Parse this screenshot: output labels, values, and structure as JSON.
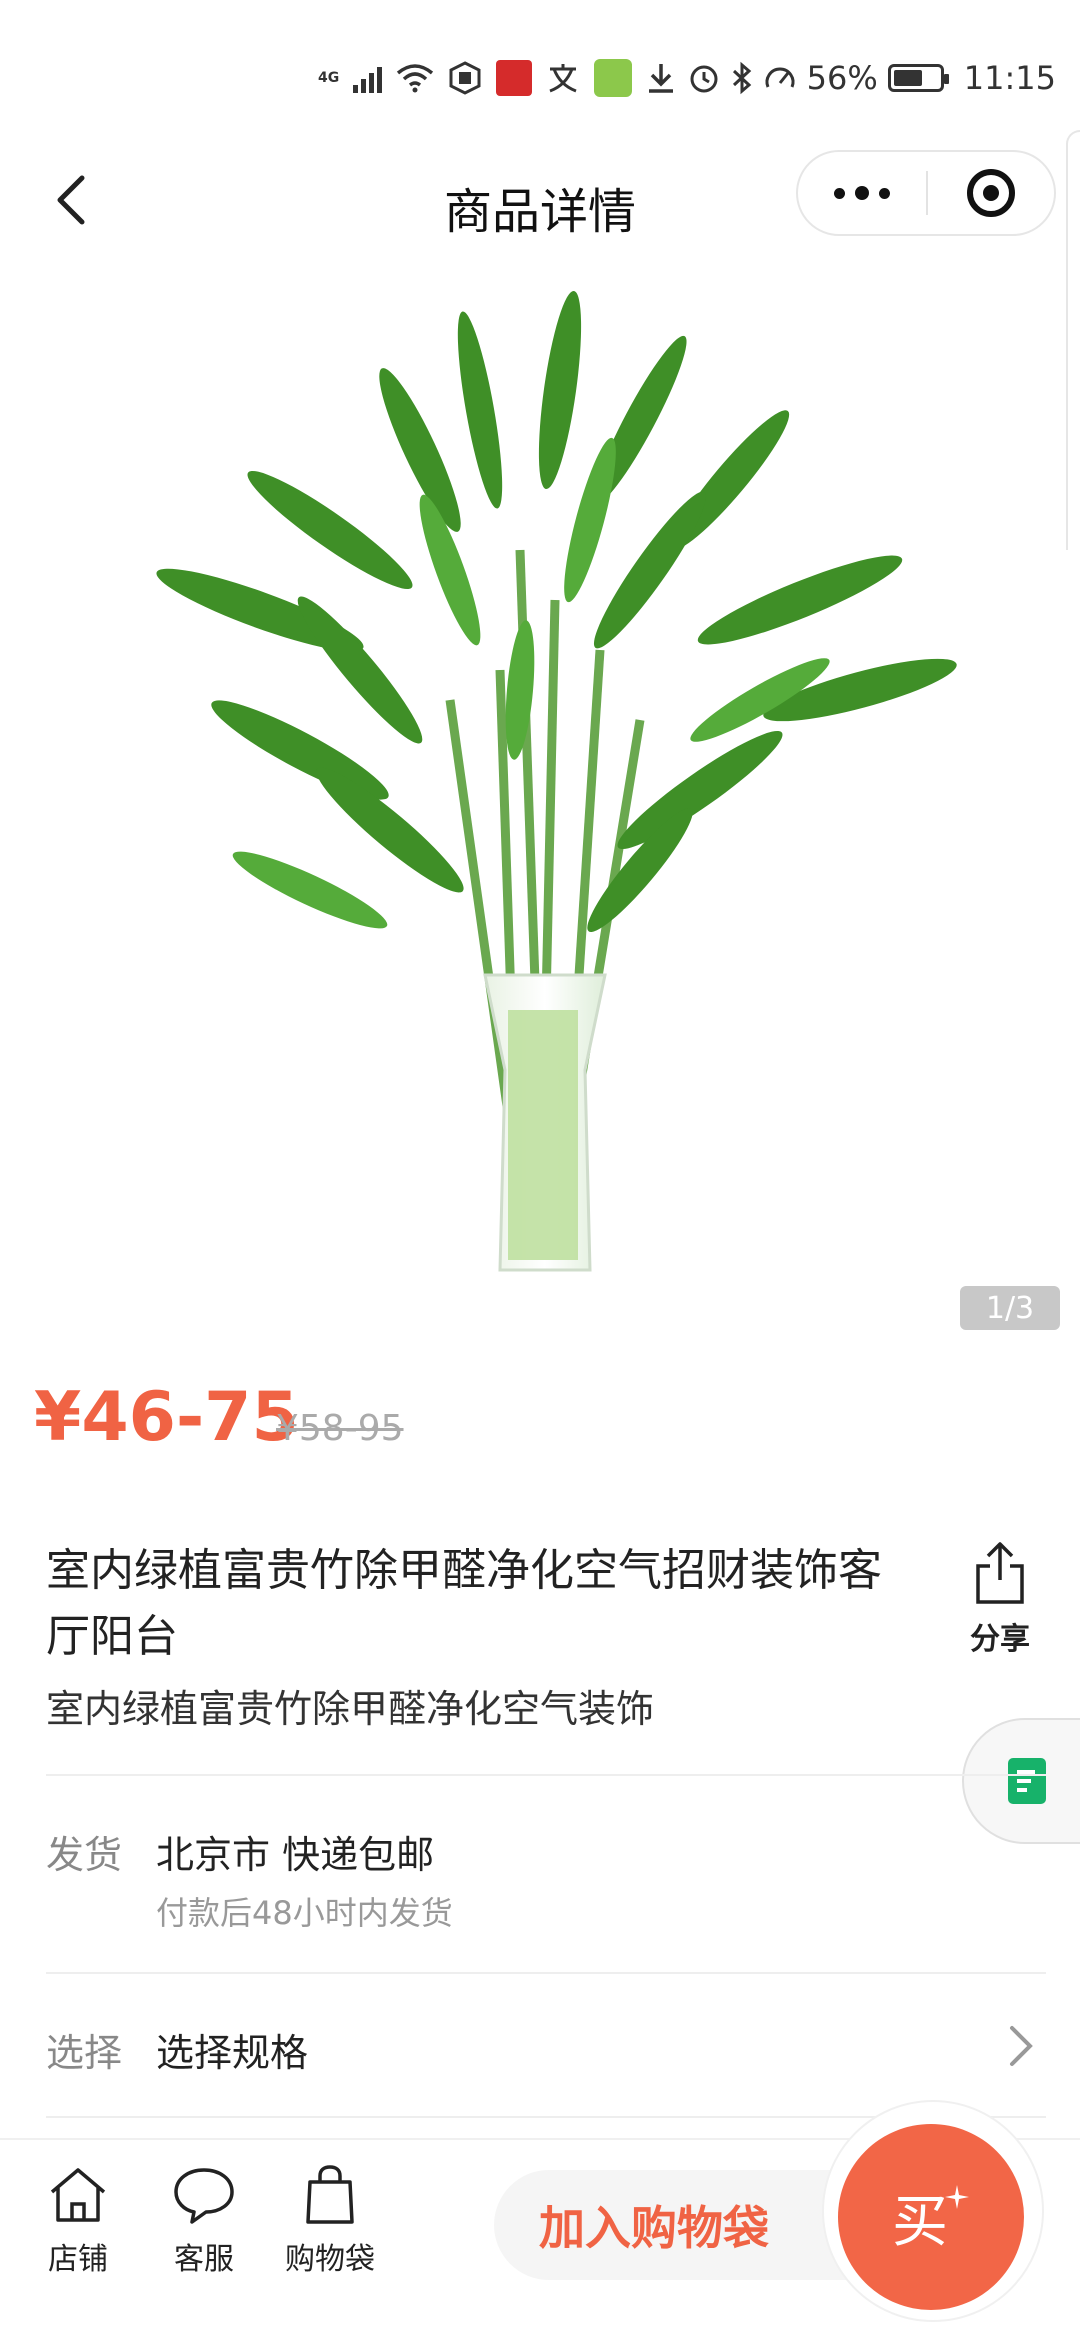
{
  "status_bar": {
    "network": "4G",
    "battery": "56%",
    "battery_level": 0.56,
    "time": "11:15"
  },
  "nav": {
    "title": "商品详情",
    "back_icon": "chevron-left-icon",
    "more_icon": "more-dots-icon",
    "close_icon": "target-circle-icon"
  },
  "product": {
    "image_counter": "1/3",
    "price": "¥46-75",
    "original_price": "¥58-95",
    "title": "室内绿植富贵竹除甲醛净化空气招财装饰客厅阳台",
    "subtitle": "室内绿植富贵竹除甲醛净化空气装饰",
    "share_label": "分享"
  },
  "shipping": {
    "label": "发货",
    "value": "北京市 快递包邮",
    "note": "付款后48小时内发货"
  },
  "spec": {
    "label": "选择",
    "value": "选择规格"
  },
  "bottom_bar": {
    "store_label": "店铺",
    "service_label": "客服",
    "bag_label": "购物袋",
    "add_to_cart": "加入购物袋",
    "buy": "买"
  },
  "colors": {
    "accent": "#f06344",
    "plant_green": "#3f8f27",
    "doc_green": "#17b26a"
  }
}
